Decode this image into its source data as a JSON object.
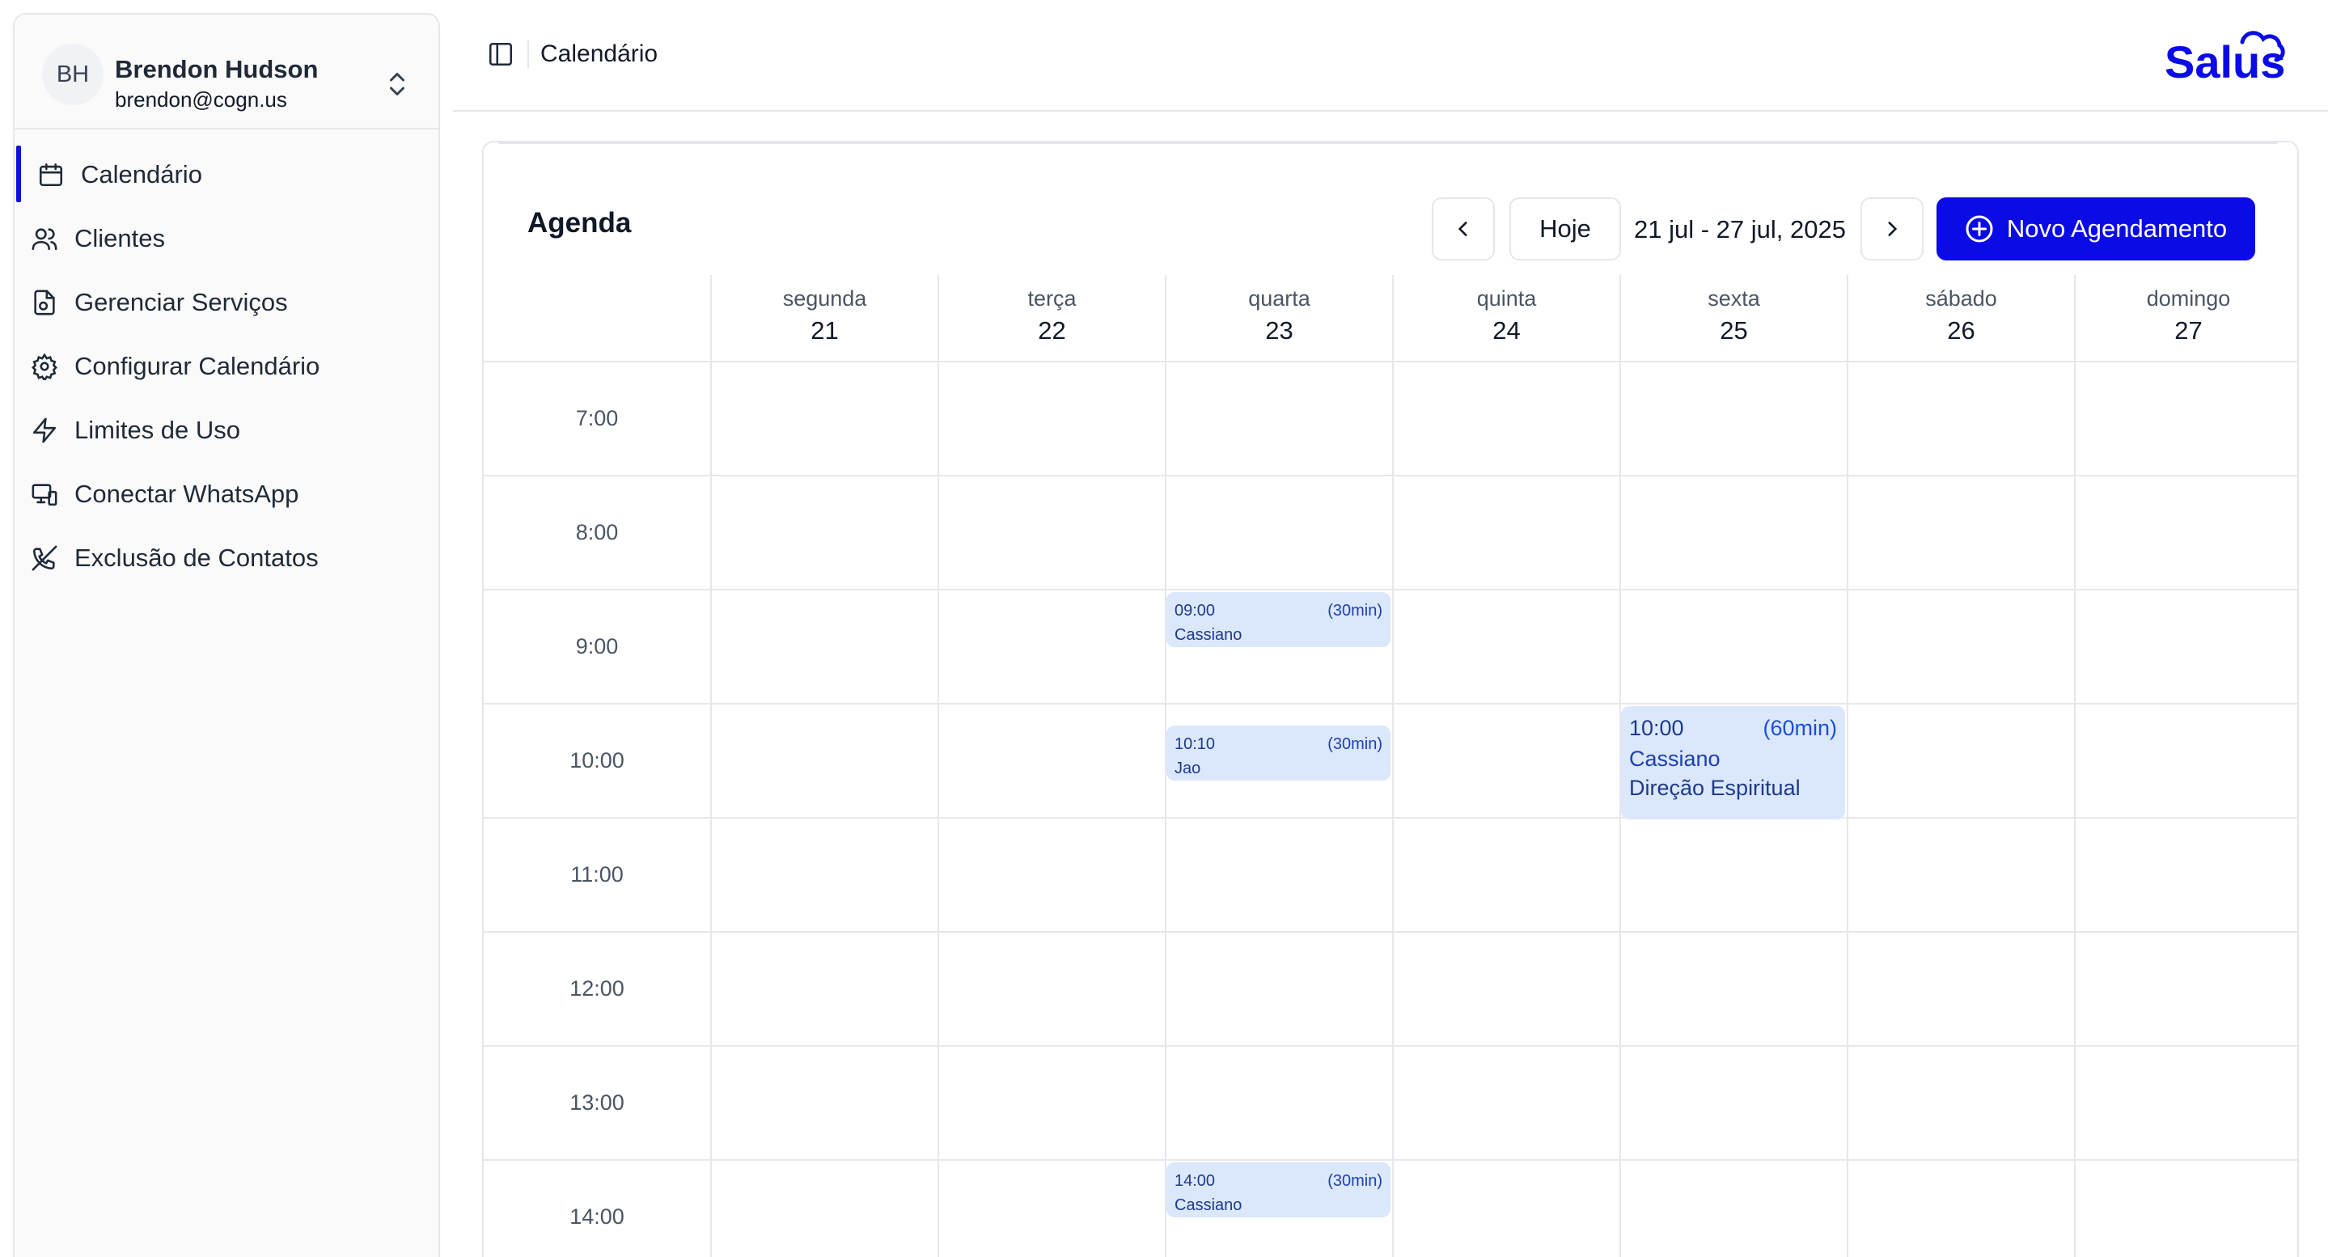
{
  "user": {
    "initials": "BH",
    "name": "Brendon Hudson",
    "email": "brendon@cogn.us"
  },
  "sidebar": {
    "items": [
      {
        "label": "Calendário",
        "icon": "calendar-icon",
        "active": true
      },
      {
        "label": "Clientes",
        "icon": "users-icon"
      },
      {
        "label": "Gerenciar Serviços",
        "icon": "file-settings-icon"
      },
      {
        "label": "Configurar Calendário",
        "icon": "gear-icon"
      },
      {
        "label": "Limites de Uso",
        "icon": "lightning-icon"
      },
      {
        "label": "Conectar WhatsApp",
        "icon": "devices-icon"
      },
      {
        "label": "Exclusão de Contatos",
        "icon": "phone-off-icon"
      }
    ]
  },
  "header": {
    "title": "Calendário",
    "logo_text": "Salus"
  },
  "agenda": {
    "title": "Agenda",
    "today_label": "Hoje",
    "range_label": "21 jul - 27 jul, 2025",
    "new_button_label": "Novo Agendamento",
    "days": [
      {
        "name": "segunda",
        "num": "21"
      },
      {
        "name": "terça",
        "num": "22"
      },
      {
        "name": "quarta",
        "num": "23"
      },
      {
        "name": "quinta",
        "num": "24"
      },
      {
        "name": "sexta",
        "num": "25"
      },
      {
        "name": "sábado",
        "num": "26"
      },
      {
        "name": "domingo",
        "num": "27"
      }
    ],
    "hours": [
      "7:00",
      "8:00",
      "9:00",
      "10:00",
      "11:00",
      "12:00",
      "13:00",
      "14:00"
    ],
    "events": [
      {
        "time": "09:00",
        "duration": "(30min)",
        "client": "Cassiano",
        "day": 2,
        "start_hour": 9.0
      },
      {
        "time": "10:10",
        "duration": "(30min)",
        "client": "Jao",
        "day": 2,
        "start_hour": 10.1667
      },
      {
        "time": "10:00",
        "duration": "(60min)",
        "client": "Cassiano",
        "service": "Direção Espiritual",
        "day": 4,
        "start_hour": 10.0
      },
      {
        "time": "14:00",
        "duration": "(30min)",
        "client": "Cassiano",
        "day": 2,
        "start_hour": 14.0
      }
    ]
  },
  "colors": {
    "accent": "#0b0be6",
    "event_bg": "#dbe7fb",
    "event_text": "#1e3a8a"
  }
}
